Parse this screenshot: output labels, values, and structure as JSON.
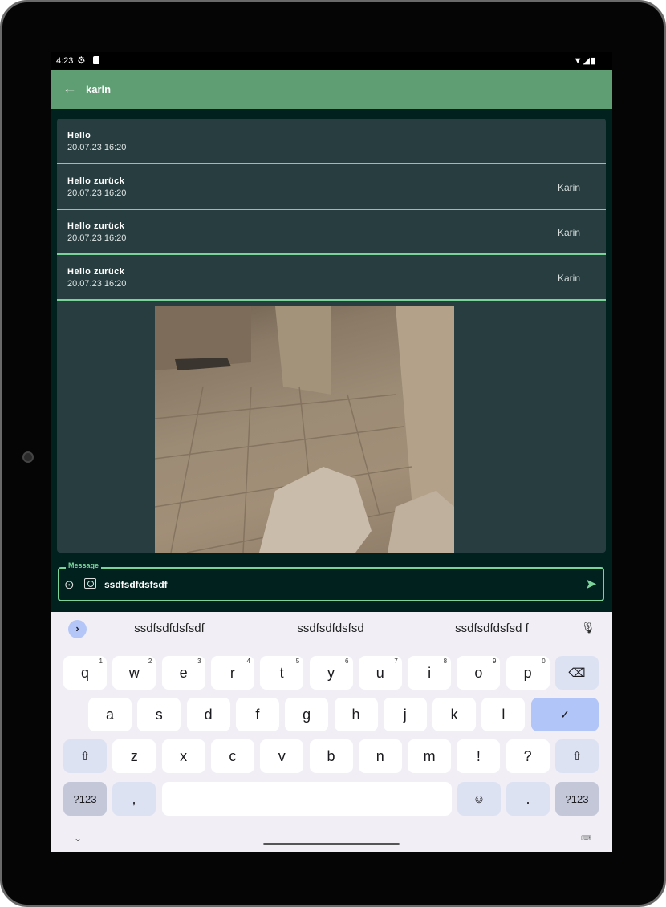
{
  "status": {
    "time": "4:23"
  },
  "appbar": {
    "title": "karin"
  },
  "messages": [
    {
      "text": "Hello",
      "date": "20.07.23 16:20",
      "author": ""
    },
    {
      "text": "Hello zurück",
      "date": "20.07.23 16:20",
      "author": "Karin"
    },
    {
      "text": "Hello zurück",
      "date": "20.07.23 16:20",
      "author": "Karin"
    },
    {
      "text": "Hello zurück",
      "date": "20.07.23 16:20",
      "author": "Karin"
    }
  ],
  "input": {
    "label": "Message",
    "value": "ssdfsdfdsfsdf"
  },
  "keyboard": {
    "suggestions": [
      "ssdfsdfdsfsdf",
      "ssdfsdfdsfsd",
      "ssdfsdfdsfsd f"
    ],
    "row1": [
      [
        "q",
        "1"
      ],
      [
        "w",
        "2"
      ],
      [
        "e",
        "3"
      ],
      [
        "r",
        "4"
      ],
      [
        "t",
        "5"
      ],
      [
        "y",
        "6"
      ],
      [
        "u",
        "7"
      ],
      [
        "i",
        "8"
      ],
      [
        "o",
        "9"
      ],
      [
        "p",
        "0"
      ]
    ],
    "row2": [
      "a",
      "s",
      "d",
      "f",
      "g",
      "h",
      "j",
      "k",
      "l"
    ],
    "row3": [
      "z",
      "x",
      "c",
      "v",
      "b",
      "n",
      "m",
      "!",
      "?"
    ],
    "symbols_label": "?123",
    "comma": ",",
    "period": "."
  },
  "colors": {
    "accent": "#7bd39a",
    "appbar": "#5f9d73",
    "background": "#01211f",
    "card": "#283d3f"
  }
}
